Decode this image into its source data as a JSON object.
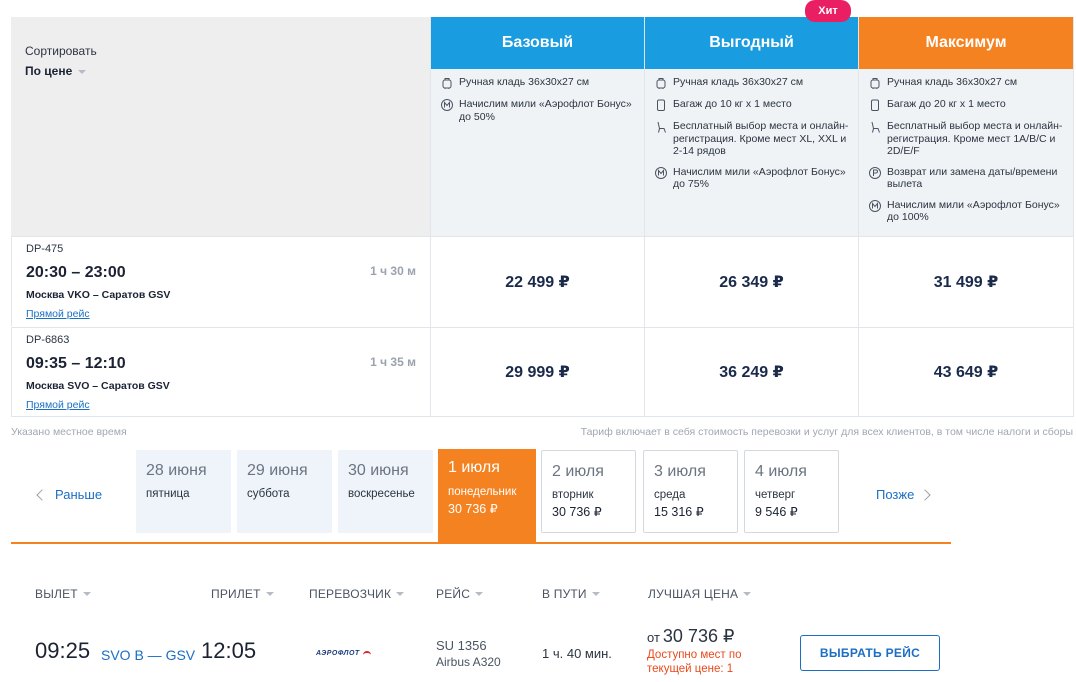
{
  "sort": {
    "label": "Сортировать",
    "value": "По цене"
  },
  "tariffs": [
    {
      "name": "Базовый",
      "color": "#1a9ce0",
      "features": [
        {
          "icon": "hand-luggage-icon",
          "text": "Ручная кладь 36x30x27 см"
        },
        {
          "icon": "miles-icon",
          "text": "Начислим мили «Аэрофлот Бонус» до 50%"
        }
      ]
    },
    {
      "name": "Выгодный",
      "color": "#1a9ce0",
      "badge": "Хит",
      "features": [
        {
          "icon": "hand-luggage-icon",
          "text": "Ручная кладь 36x30x27 см"
        },
        {
          "icon": "baggage-icon",
          "text": "Багаж до 10 кг x 1 место"
        },
        {
          "icon": "seat-icon",
          "text": "Бесплатный выбор места и онлайн-регистрация. Кроме мест XL, XXL и 2-14 рядов"
        },
        {
          "icon": "miles-icon",
          "text": "Начислим мили «Аэрофлот Бонус» до 75%"
        }
      ]
    },
    {
      "name": "Максимум",
      "color": "#f58220",
      "features": [
        {
          "icon": "hand-luggage-icon",
          "text": "Ручная кладь 36x30x27 см"
        },
        {
          "icon": "baggage-icon",
          "text": "Багаж до 20 кг x 1 место"
        },
        {
          "icon": "seat-icon",
          "text": "Бесплатный выбор места и онлайн-регистрация. Кроме мест 1A/B/C и 2D/E/F"
        },
        {
          "icon": "refund-icon",
          "text": "Возврат или замена даты/времени вылета"
        },
        {
          "icon": "miles-icon",
          "text": "Начислим мили «Аэрофлот Бонус» до 100%"
        }
      ]
    }
  ],
  "flights": [
    {
      "number": "DP-475",
      "time": "20:30 – 23:00",
      "route": "Москва VKO – Саратов GSV",
      "duration": "1 ч 30 м",
      "direct": "Прямой рейс",
      "prices": [
        "22 499 ₽",
        "26 349 ₽",
        "31 499 ₽"
      ]
    },
    {
      "number": "DP-6863",
      "time": "09:35 – 12:10",
      "route": "Москва SVO – Саратов GSV",
      "duration": "1 ч 35 м",
      "direct": "Прямой рейс",
      "prices": [
        "29 999 ₽",
        "36 249 ₽",
        "43 649 ₽"
      ]
    }
  ],
  "notes": {
    "local_time": "Указано местное время",
    "tariff_includes": "Тариф включает в себя стоимость перевозки и услуг для всех клиентов, в том числе налоги и сборы"
  },
  "date_nav": {
    "prev": "Раньше",
    "next": "Позже",
    "days": [
      {
        "date": "28 июня",
        "weekday": "пятница",
        "price": "",
        "state": "past"
      },
      {
        "date": "29 июня",
        "weekday": "суббота",
        "price": "",
        "state": "past"
      },
      {
        "date": "30 июня",
        "weekday": "воскресенье",
        "price": "",
        "state": "past"
      },
      {
        "date": "1 июля",
        "weekday": "понедельник",
        "price": "30 736 ₽",
        "state": "active"
      },
      {
        "date": "2 июля",
        "weekday": "вторник",
        "price": "30 736 ₽",
        "state": "future"
      },
      {
        "date": "3 июля",
        "weekday": "среда",
        "price": "15 316 ₽",
        "state": "future"
      },
      {
        "date": "4 июля",
        "weekday": "четверг",
        "price": "9 546 ₽",
        "state": "future"
      }
    ]
  },
  "columns": {
    "departure": "ВЫЛЕТ",
    "arrival": "ПРИЛЕТ",
    "carrier": "ПЕРЕВОЗЧИК",
    "flight": "РЕЙС",
    "duration": "В ПУТИ",
    "best_price": "ЛУЧШАЯ ЦЕНА"
  },
  "result": {
    "departure_time": "09:25",
    "route": "SVO B — GSV",
    "arrival_time": "12:05",
    "carrier_logo_text": "АЭРОФЛОТ",
    "flight_number": "SU 1356",
    "aircraft": "Airbus A320",
    "duration": "1 ч. 40 мин.",
    "price_from": "от",
    "price": "30 736 ₽",
    "availability": "Доступно мест по текущей цене: 1",
    "select_button": "ВЫБРАТЬ РЕЙС"
  },
  "colors": {
    "blue_header": "#1a9ce0",
    "orange_header": "#f58220",
    "badge": "#e91e63",
    "link": "#1a6ec4",
    "warning": "#e8491d"
  }
}
